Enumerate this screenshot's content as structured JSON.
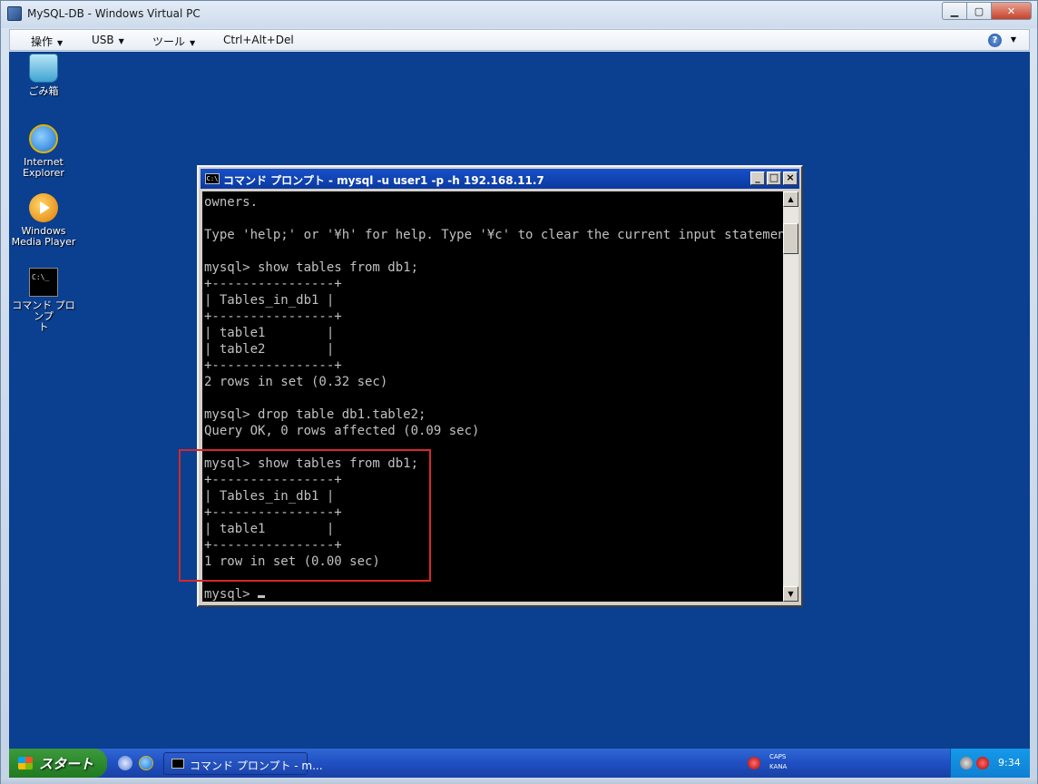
{
  "host": {
    "title": "MySQL-DB - Windows Virtual PC",
    "menu": [
      {
        "label": "操作"
      },
      {
        "label": "USB"
      },
      {
        "label": "ツール"
      },
      {
        "label": "Ctrl+Alt+Del"
      }
    ],
    "help": "?"
  },
  "desktop": {
    "icons": [
      {
        "label": "ごみ箱",
        "icon": "recycle-bin-icon"
      },
      {
        "label": "Internet\nExplorer",
        "icon": "internet-explorer-icon"
      },
      {
        "label": "Windows\nMedia Player",
        "icon": "media-player-icon"
      },
      {
        "label": "コマンド プロンプ\nト",
        "icon": "command-prompt-icon"
      }
    ]
  },
  "cmd": {
    "title": "コマンド プロンプト - mysql -u user1 -p -h 192.168.11.7",
    "icon_text": "C:\\",
    "lines": [
      "owners.",
      "",
      "Type 'help;' or '¥h' for help. Type '¥c' to clear the current input statement.",
      "",
      "mysql> show tables from db1;",
      "+----------------+",
      "| Tables_in_db1 |",
      "+----------------+",
      "| table1        |",
      "| table2        |",
      "+----------------+",
      "2 rows in set (0.32 sec)",
      "",
      "mysql> drop table db1.table2;",
      "Query OK, 0 rows affected (0.09 sec)",
      "",
      "mysql> show tables from db1;",
      "+----------------+",
      "| Tables_in_db1 |",
      "+----------------+",
      "| table1        |",
      "+----------------+",
      "1 row in set (0.00 sec)",
      ""
    ],
    "prompt": "mysql>",
    "highlight_color": "#d8282a"
  },
  "taskbar": {
    "start_label": "スタート",
    "task_label": "コマンド プロンプト - m...",
    "caps": "CAPS",
    "kana": "KANA",
    "clock": "9:34"
  }
}
